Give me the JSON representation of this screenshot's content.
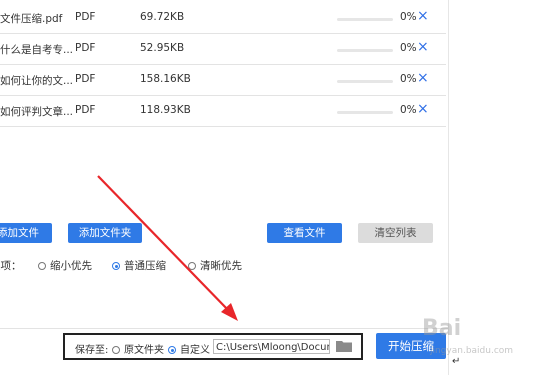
{
  "files": [
    {
      "name": "文件压缩.pdf",
      "type": "PDF",
      "size": "69.72KB",
      "progress": 0,
      "percent": "0%"
    },
    {
      "name": "什么是自考专...",
      "type": "PDF",
      "size": "52.95KB",
      "progress": 0,
      "percent": "0%"
    },
    {
      "name": "如何让你的文...",
      "type": "PDF",
      "size": "158.16KB",
      "progress": 0,
      "percent": "0%"
    },
    {
      "name": "如何评判文章...",
      "type": "PDF",
      "size": "118.93KB",
      "progress": 0,
      "percent": "0%"
    }
  ],
  "delete_symbol": "×",
  "actions": {
    "add_file": "添加文件",
    "add_folder": "添加文件夹",
    "view_files": "查看文件",
    "clear_list": "清空列表"
  },
  "compress_options": {
    "label": "选项：",
    "items": [
      {
        "label": "缩小优先",
        "selected": false
      },
      {
        "label": "普通压缩",
        "selected": true
      },
      {
        "label": "清晰优先",
        "selected": false
      }
    ]
  },
  "save": {
    "label": "保存至:",
    "original_folder": "原文件夹",
    "custom": "自定义",
    "custom_selected": true,
    "path": "C:\\Users\\Mloong\\Documents",
    "folder_icon": "folder-icon"
  },
  "start_button": "开始压缩",
  "watermark": {
    "text": "Bai",
    "sub": "jingyan.baidu.com"
  },
  "colors": {
    "accent": "#2f7ae6",
    "annotation_arrow": "#e8262a"
  }
}
